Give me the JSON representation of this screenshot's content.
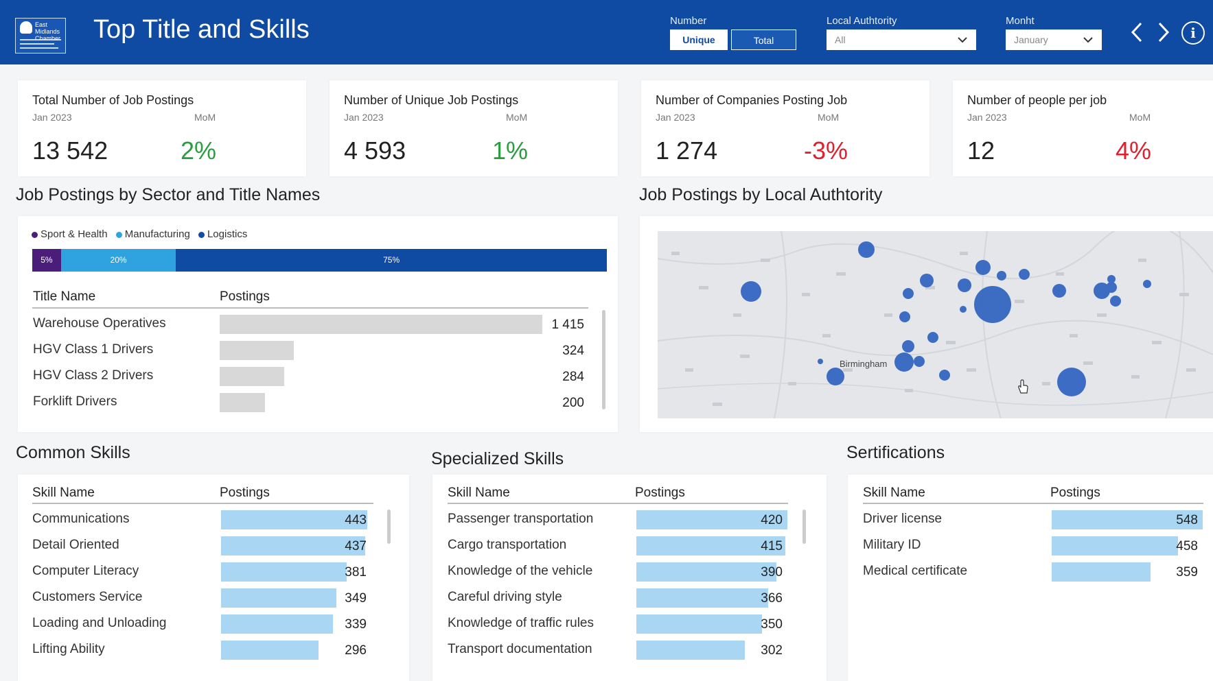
{
  "header": {
    "logo_text": "East Midlands Chamber",
    "title": "Top Title and Skills",
    "number_label": "Number",
    "number_options": [
      "Unique",
      "Total"
    ],
    "local_authority_label": "Local Authtority",
    "local_authority_value": "All",
    "month_label": "Monht",
    "month_value": "January",
    "prev_icon": "chevron-left-icon",
    "next_icon": "chevron-right-icon",
    "info_icon": "info-icon",
    "info_glyph": "i",
    "chevron_glyph": "⌄"
  },
  "kpis": [
    {
      "title": "Total Number of Job Postings",
      "period": "Jan 2023",
      "mom_label": "MoM",
      "value": "13 542",
      "mom": "2%",
      "mom_color": "#2a9d3f"
    },
    {
      "title": "Number of Unique Job Postings",
      "period": "Jan 2023",
      "mom_label": "MoM",
      "value": "4 593",
      "mom": "1%",
      "mom_color": "#2a9d3f"
    },
    {
      "title": "Number of Companies Posting Job",
      "period": "Jan 2023",
      "mom_label": "MoM",
      "value": "1 274",
      "mom": "-3%",
      "mom_color": "#e0202e"
    },
    {
      "title": "Number of people per job",
      "period": "Jan 2023",
      "mom_label": "MoM",
      "value": "12",
      "mom": "4%",
      "mom_color": "#e0202e"
    }
  ],
  "sector": {
    "title": "Job Postings by Sector and Title Names",
    "legend": [
      {
        "name": "Sport & Health",
        "color": "#4a1d7a"
      },
      {
        "name": "Manufacturing",
        "color": "#2ea3e0"
      },
      {
        "name": "Logistics",
        "color": "#0f4aa3"
      }
    ],
    "shares": [
      {
        "label": "5%",
        "value": 5,
        "color": "#4a1d7a"
      },
      {
        "label": "20%",
        "value": 20,
        "color": "#2ea3e0"
      },
      {
        "label": "75%",
        "value": 75,
        "color": "#0f4aa3"
      }
    ],
    "col_title": "Title Name",
    "col_postings": "Postings",
    "rows": [
      {
        "name": "Warehouse Operatives",
        "value": "1 415",
        "n": 1415
      },
      {
        "name": "HGV Class 1 Drivers",
        "value": "324",
        "n": 324
      },
      {
        "name": "HGV Class 2 Drivers",
        "value": "284",
        "n": 284
      },
      {
        "name": "Forklift Drivers",
        "value": "200",
        "n": 200
      }
    ]
  },
  "map": {
    "title": "Job Postings by Local Authtority",
    "city_label": "Birmingham",
    "cursor_icon": "hand-cursor-icon"
  },
  "common_skills": {
    "title": "Common Skills",
    "col_name": "Skill Name",
    "col_postings": "Postings",
    "rows": [
      {
        "name": "Communications",
        "value": "443",
        "n": 443
      },
      {
        "name": "Detail Oriented",
        "value": "437",
        "n": 437
      },
      {
        "name": "Computer Literacy",
        "value": "381",
        "n": 381
      },
      {
        "name": "Customers Service",
        "value": "349",
        "n": 349
      },
      {
        "name": "Loading and Unloading",
        "value": "339",
        "n": 339
      },
      {
        "name": "Lifting Ability",
        "value": "296",
        "n": 296
      }
    ]
  },
  "specialized_skills": {
    "title": "Specialized Skills",
    "col_name": "Skill Name",
    "col_postings": "Postings",
    "rows": [
      {
        "name": "Passenger transportation",
        "value": "420",
        "n": 420
      },
      {
        "name": "Cargo transportation",
        "value": "415",
        "n": 415
      },
      {
        "name": "Knowledge of the vehicle",
        "value": "390",
        "n": 390
      },
      {
        "name": "Careful driving style",
        "value": "366",
        "n": 366
      },
      {
        "name": "Knowledge of traffic rules",
        "value": "350",
        "n": 350
      },
      {
        "name": "Transport documentation",
        "value": "302",
        "n": 302
      }
    ]
  },
  "certifications": {
    "title": "Sertifications",
    "col_name": "Skill Name",
    "col_postings": "Postings",
    "rows": [
      {
        "name": "Driver license",
        "value": "548",
        "n": 548
      },
      {
        "name": "Military ID",
        "value": "458",
        "n": 458
      },
      {
        "name": "Medical certificate",
        "value": "359",
        "n": 359
      }
    ]
  }
}
